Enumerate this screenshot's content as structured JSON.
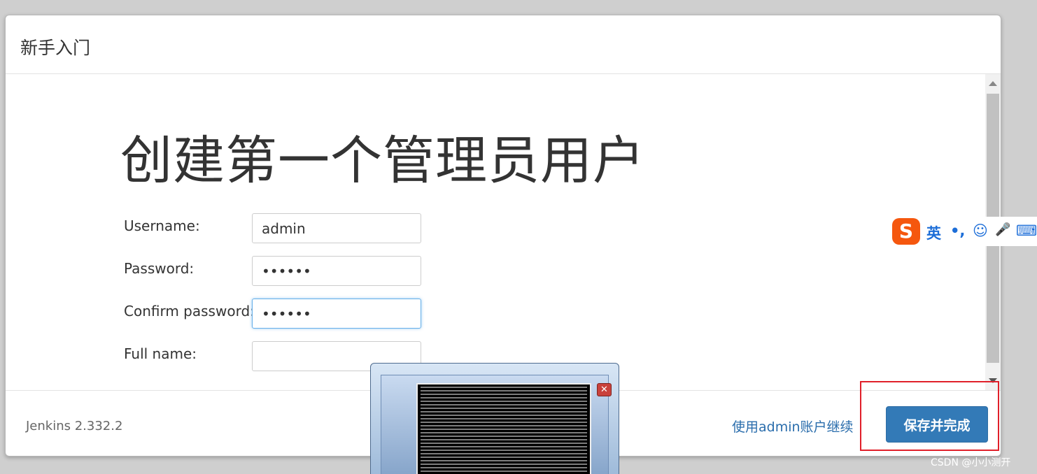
{
  "dialog": {
    "title": "新手入门",
    "page_title": "创建第一个管理员用户"
  },
  "form": {
    "username_label": "Username:",
    "username_value": "admin",
    "password_label": "Password:",
    "password_value": "••••••",
    "confirm_label": "Confirm password:",
    "confirm_value": "••••••",
    "fullname_label": "Full name:",
    "fullname_value": ""
  },
  "footer": {
    "version": "Jenkins 2.332.2",
    "continue_link": "使用admin账户继续",
    "save_button": "保存并完成"
  },
  "ime": {
    "logo": "S",
    "mode": "英",
    "punct": "•,",
    "emoji": "☺",
    "mic": "🎤",
    "keyboard": "⌨"
  },
  "popup": {
    "close": "✕"
  },
  "watermark": "CSDN @小小测开",
  "colors": {
    "primary": "#337ab7",
    "link": "#2a6dac",
    "highlight": "#e0202a",
    "ime_orange": "#f5570e"
  }
}
